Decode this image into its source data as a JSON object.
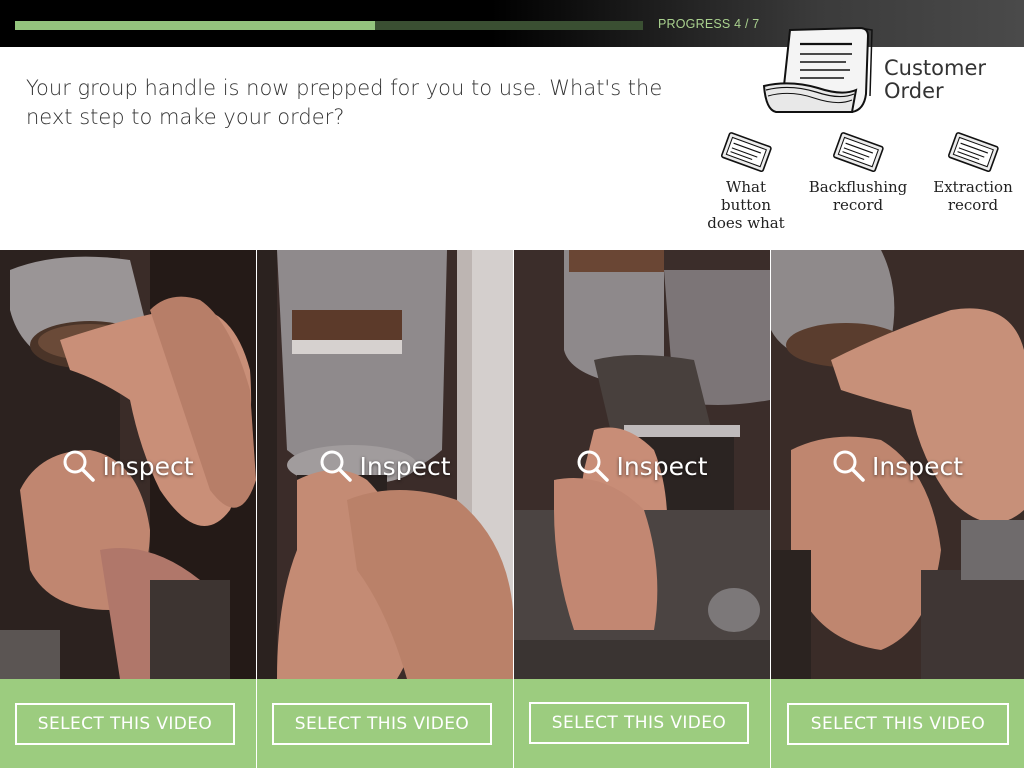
{
  "progress": {
    "label": "PROGRESS 4 / 7",
    "fraction": 0.5731
  },
  "question": "Your group handle is now prepped for you to use. What's the next step to make your order?",
  "customer_order": {
    "label_line1": "Customer",
    "label_line2": "Order",
    "icon": "receipt-icon"
  },
  "resources": [
    {
      "line1": "What",
      "line2": "button",
      "line3": "does what",
      "icon": "ticket-icon"
    },
    {
      "line1": "Backflushing",
      "line2": "record",
      "icon": "ticket-icon"
    },
    {
      "line1": "Extraction",
      "line2": "record",
      "icon": "ticket-icon"
    }
  ],
  "videos": [
    {
      "inspect_label": "Inspect",
      "select_label": "SELECT THIS VIDEO"
    },
    {
      "inspect_label": "Inspect",
      "select_label": "SELECT THIS VIDEO"
    },
    {
      "inspect_label": "Inspect",
      "select_label": "SELECT THIS VIDEO"
    },
    {
      "inspect_label": "Inspect",
      "select_label": "SELECT THIS VIDEO"
    }
  ],
  "colors": {
    "accent_green": "#9ccc7f",
    "progress_fill": "#93c47d",
    "progress_text": "#a9d18e",
    "top_bar": "#000000"
  }
}
